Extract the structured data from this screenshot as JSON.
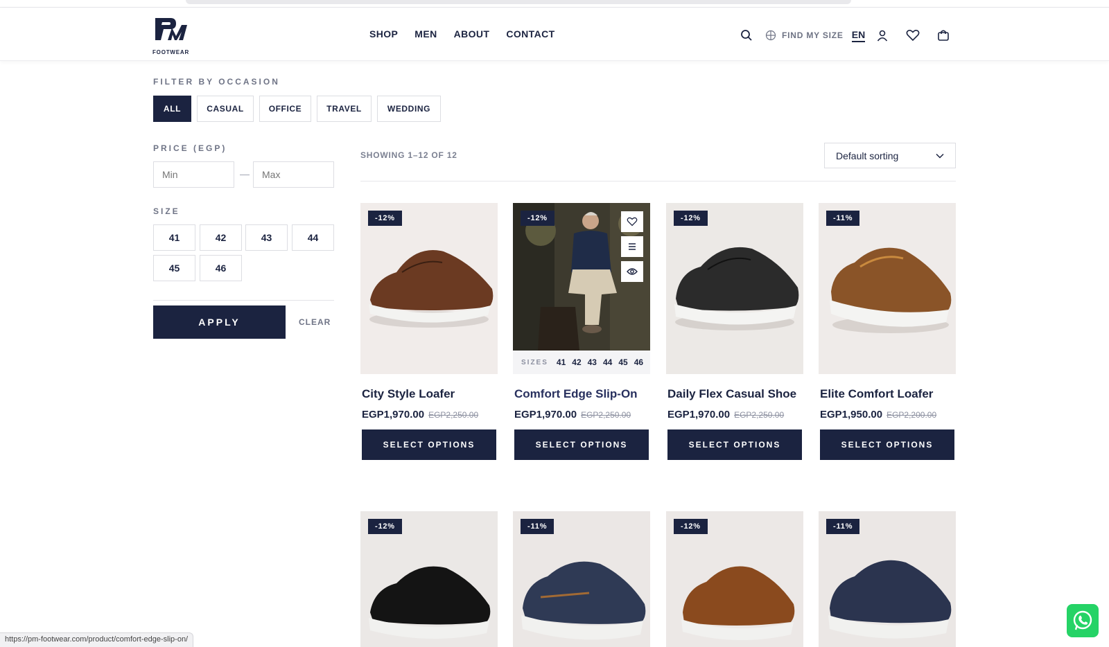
{
  "header": {
    "brand": "FOOTWEAR",
    "nav": [
      "SHOP",
      "MEN",
      "ABOUT",
      "CONTACT"
    ],
    "find_my_size": "FIND MY SIZE",
    "language": "EN",
    "icons": [
      "search-icon",
      "globe-icon",
      "user-icon",
      "heart-icon",
      "cart-icon"
    ]
  },
  "filters": {
    "occasion_label": "FILTER BY OCCASION",
    "occasions": [
      "ALL",
      "CASUAL",
      "OFFICE",
      "TRAVEL",
      "WEDDING"
    ],
    "active_occasion": "ALL",
    "price_label": "PRICE (EGP)",
    "min_placeholder": "Min",
    "max_placeholder": "Max",
    "price_separator": "—",
    "size_label": "SIZE",
    "sizes": [
      "41",
      "42",
      "43",
      "44",
      "45",
      "46"
    ],
    "apply": "APPLY",
    "clear": "CLEAR"
  },
  "results": {
    "showing": "SHOWING 1–12 OF 12",
    "sorting": "Default sorting"
  },
  "products": [
    {
      "name": "City Style Loafer",
      "price": "EGP1,970.00",
      "old_price": "EGP2,250.00",
      "badge": "-12%",
      "button": "SELECT OPTIONS",
      "shoe_color": "#6b3a22"
    },
    {
      "name": "Comfort Edge Slip-On",
      "price": "EGP1,970.00",
      "old_price": "EGP2,250.00",
      "badge": "-12%",
      "button": "SELECT OPTIONS",
      "sizes_label": "SIZES",
      "sizes": [
        "41",
        "42",
        "43",
        "44",
        "45",
        "46"
      ]
    },
    {
      "name": "Daily Flex Casual Shoe",
      "price": "EGP1,970.00",
      "old_price": "EGP2,250.00",
      "badge": "-12%",
      "button": "SELECT OPTIONS",
      "shoe_color": "#2b2b2b"
    },
    {
      "name": "Elite Comfort Loafer",
      "price": "EGP1,950.00",
      "old_price": "EGP2,200.00",
      "badge": "-11%",
      "button": "SELECT OPTIONS",
      "shoe_color": "#8a5428"
    }
  ],
  "products_row2": [
    {
      "badge": "-12%",
      "shoe_color": "#141414"
    },
    {
      "badge": "-11%",
      "shoe_color": "#2f3a55"
    },
    {
      "badge": "-12%",
      "shoe_color": "#8a4a1e"
    },
    {
      "badge": "-11%",
      "shoe_color": "#2b344f"
    }
  ],
  "status_url": "https://pm-footwear.com/product/comfort-edge-slip-on/",
  "colors": {
    "primary": "#1b2340",
    "whatsapp": "#25d366"
  }
}
